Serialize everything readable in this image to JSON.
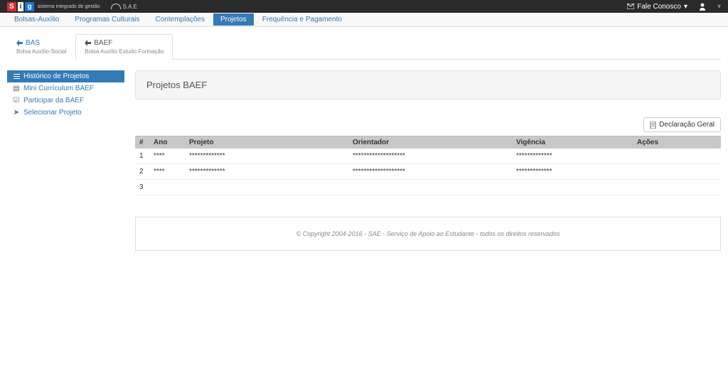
{
  "topbar": {
    "logo_text": "sistema integrado de gestão",
    "sae": "S.A.E",
    "fale_conosco": "Fale Conosco",
    "dropdown_caret": "▾"
  },
  "menubar": {
    "items": [
      {
        "label": "Bolsas-Auxílio",
        "active": false
      },
      {
        "label": "Programas Culturais",
        "active": false
      },
      {
        "label": "Contemplações",
        "active": false
      },
      {
        "label": "Projetos",
        "active": true
      },
      {
        "label": "Frequência e Pagamento",
        "active": false
      }
    ]
  },
  "tabs": [
    {
      "title": "BAS",
      "sub": "Bolsa Auxílio-Social",
      "active": false
    },
    {
      "title": "BAEF",
      "sub": "Bolsa Auxílio Estudo Formação",
      "active": true
    }
  ],
  "sidebar": {
    "items": [
      {
        "label": "Histórico de Projetos",
        "active": true,
        "icon": "list"
      },
      {
        "label": "Mini Currículum BAEF",
        "active": false,
        "icon": "doc"
      },
      {
        "label": "Participar da BAEF",
        "active": false,
        "icon": "check"
      },
      {
        "label": "Selecionar Projeto",
        "active": false,
        "icon": "pointer"
      }
    ]
  },
  "main": {
    "title": "Projetos BAEF",
    "declaration_btn": "Declaração Geral",
    "table": {
      "headers": [
        "#",
        "Ano",
        "Projeto",
        "Orientador",
        "Vigência",
        "Ações"
      ],
      "rows": [
        {
          "num": "1",
          "ano": "****",
          "projeto": "*************",
          "orientador": "*******************",
          "vigencia": "*************",
          "acoes": ""
        },
        {
          "num": "2",
          "ano": "****",
          "projeto": "*************",
          "orientador": "*******************",
          "vigencia": "*************",
          "acoes": ""
        },
        {
          "num": "3",
          "ano": "",
          "projeto": "",
          "orientador": "",
          "vigencia": "",
          "acoes": ""
        }
      ]
    }
  },
  "footer": "© Copyright 2004-2016 - SAE - Serviço de Apoio ao Estudante - todos os direitos reservados"
}
